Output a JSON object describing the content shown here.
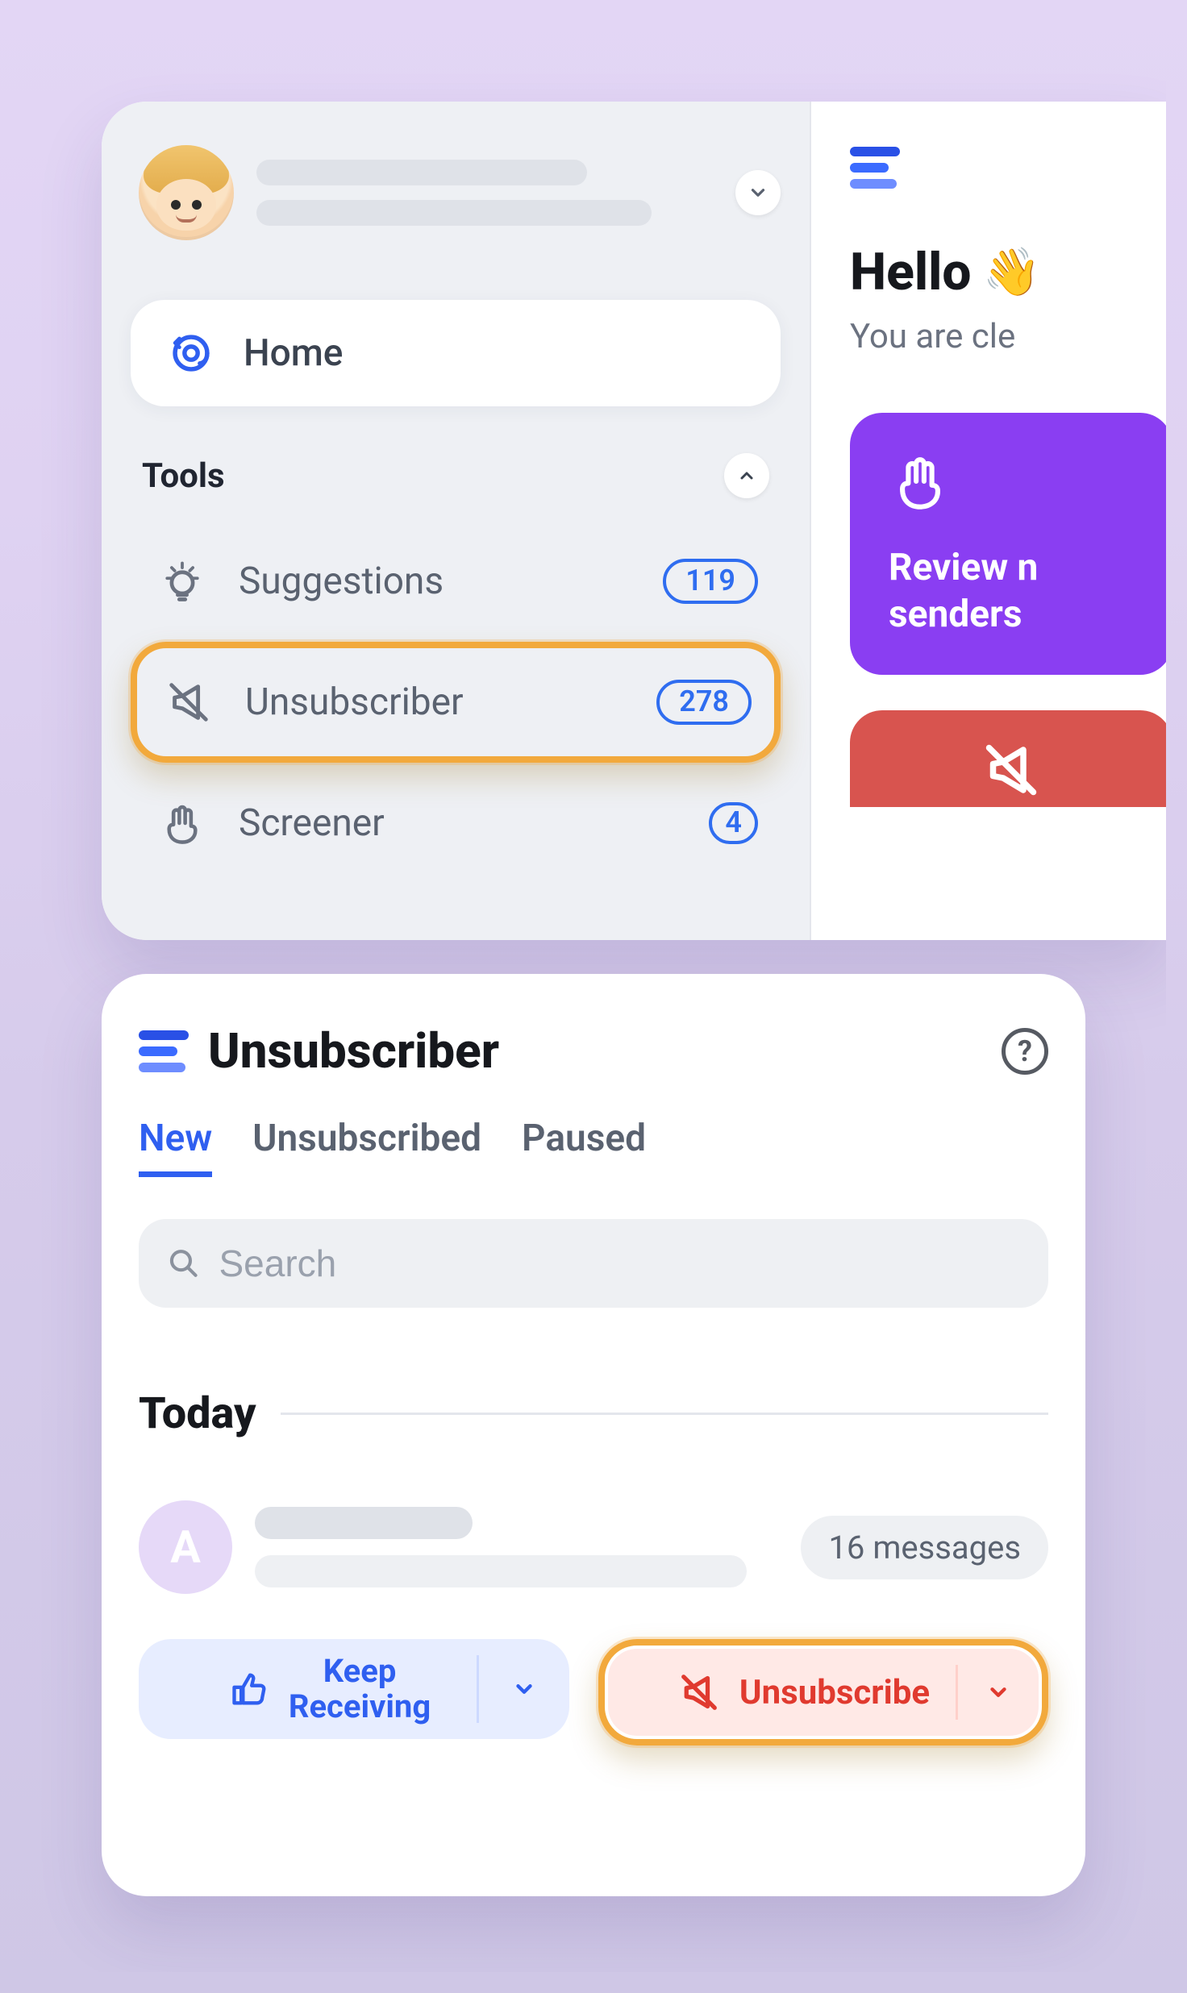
{
  "sidebar": {
    "home_label": "Home",
    "tools_label": "Tools",
    "items": [
      {
        "label": "Suggestions",
        "badge": "119",
        "icon": "lightbulb-icon"
      },
      {
        "label": "Unsubscriber",
        "badge": "278",
        "icon": "megaphone-off-icon",
        "highlighted": true
      },
      {
        "label": "Screener",
        "badge": "4",
        "icon": "hand-icon"
      }
    ]
  },
  "main": {
    "hello_title": "Hello",
    "hello_wave": "👋",
    "hello_subtitle": "You are cle",
    "review_card": {
      "line1": "Review n",
      "line2": "senders"
    }
  },
  "unsubscriber": {
    "title": "Unsubscriber",
    "tabs": [
      {
        "label": "New",
        "active": true
      },
      {
        "label": "Unsubscribed",
        "active": false
      },
      {
        "label": "Paused",
        "active": false
      }
    ],
    "search_placeholder": "Search",
    "section_label": "Today",
    "sender": {
      "initial": "A",
      "message_count_label": "16 messages"
    },
    "actions": {
      "keep_line1": "Keep",
      "keep_line2": "Receiving",
      "unsubscribe_label": "Unsubscribe"
    }
  },
  "colors": {
    "accent_blue": "#2f5ff0",
    "highlight_orange": "#f2a93c",
    "purple_card": "#8a3ef2",
    "danger_red": "#e03a2f"
  }
}
